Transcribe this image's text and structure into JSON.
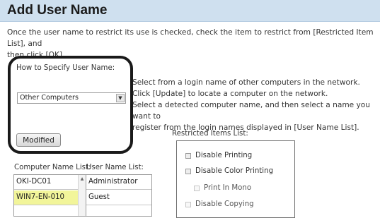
{
  "header": {
    "title": "Add User Name"
  },
  "intro": {
    "line1": "Once the user name to restrict its use is checked, check the item to restrict from [Restricted Item List], and",
    "line2": "then click [OK]."
  },
  "specify": {
    "label": "How to Specify User Name:",
    "selected": "Other Computers",
    "modified_button": "Modified"
  },
  "help": {
    "line1": "Select from a login name of other computers in the network.",
    "line2": "Click [Update] to locate a computer on the network.",
    "line3": "Select a detected computer name, and then select a name you want to",
    "line4": "register from the login names displayed in [User Name List]."
  },
  "computer_list": {
    "label": "Computer Name List:",
    "items": [
      "OKI-DC01",
      "WIN7-EN-010"
    ],
    "selected_index": 1
  },
  "user_list": {
    "label": "User Name List:",
    "items": [
      "Administrator",
      "Guest"
    ]
  },
  "restricted": {
    "label": "Restricted Items List:",
    "items": [
      {
        "label": "Disable Printing",
        "checked": false
      },
      {
        "label": "Disable Color Printing",
        "checked": false
      },
      {
        "label": "Print In Mono",
        "checked": false,
        "disabled": true
      },
      {
        "label": "Disable Copying",
        "checked": false,
        "disabled": true
      }
    ]
  }
}
